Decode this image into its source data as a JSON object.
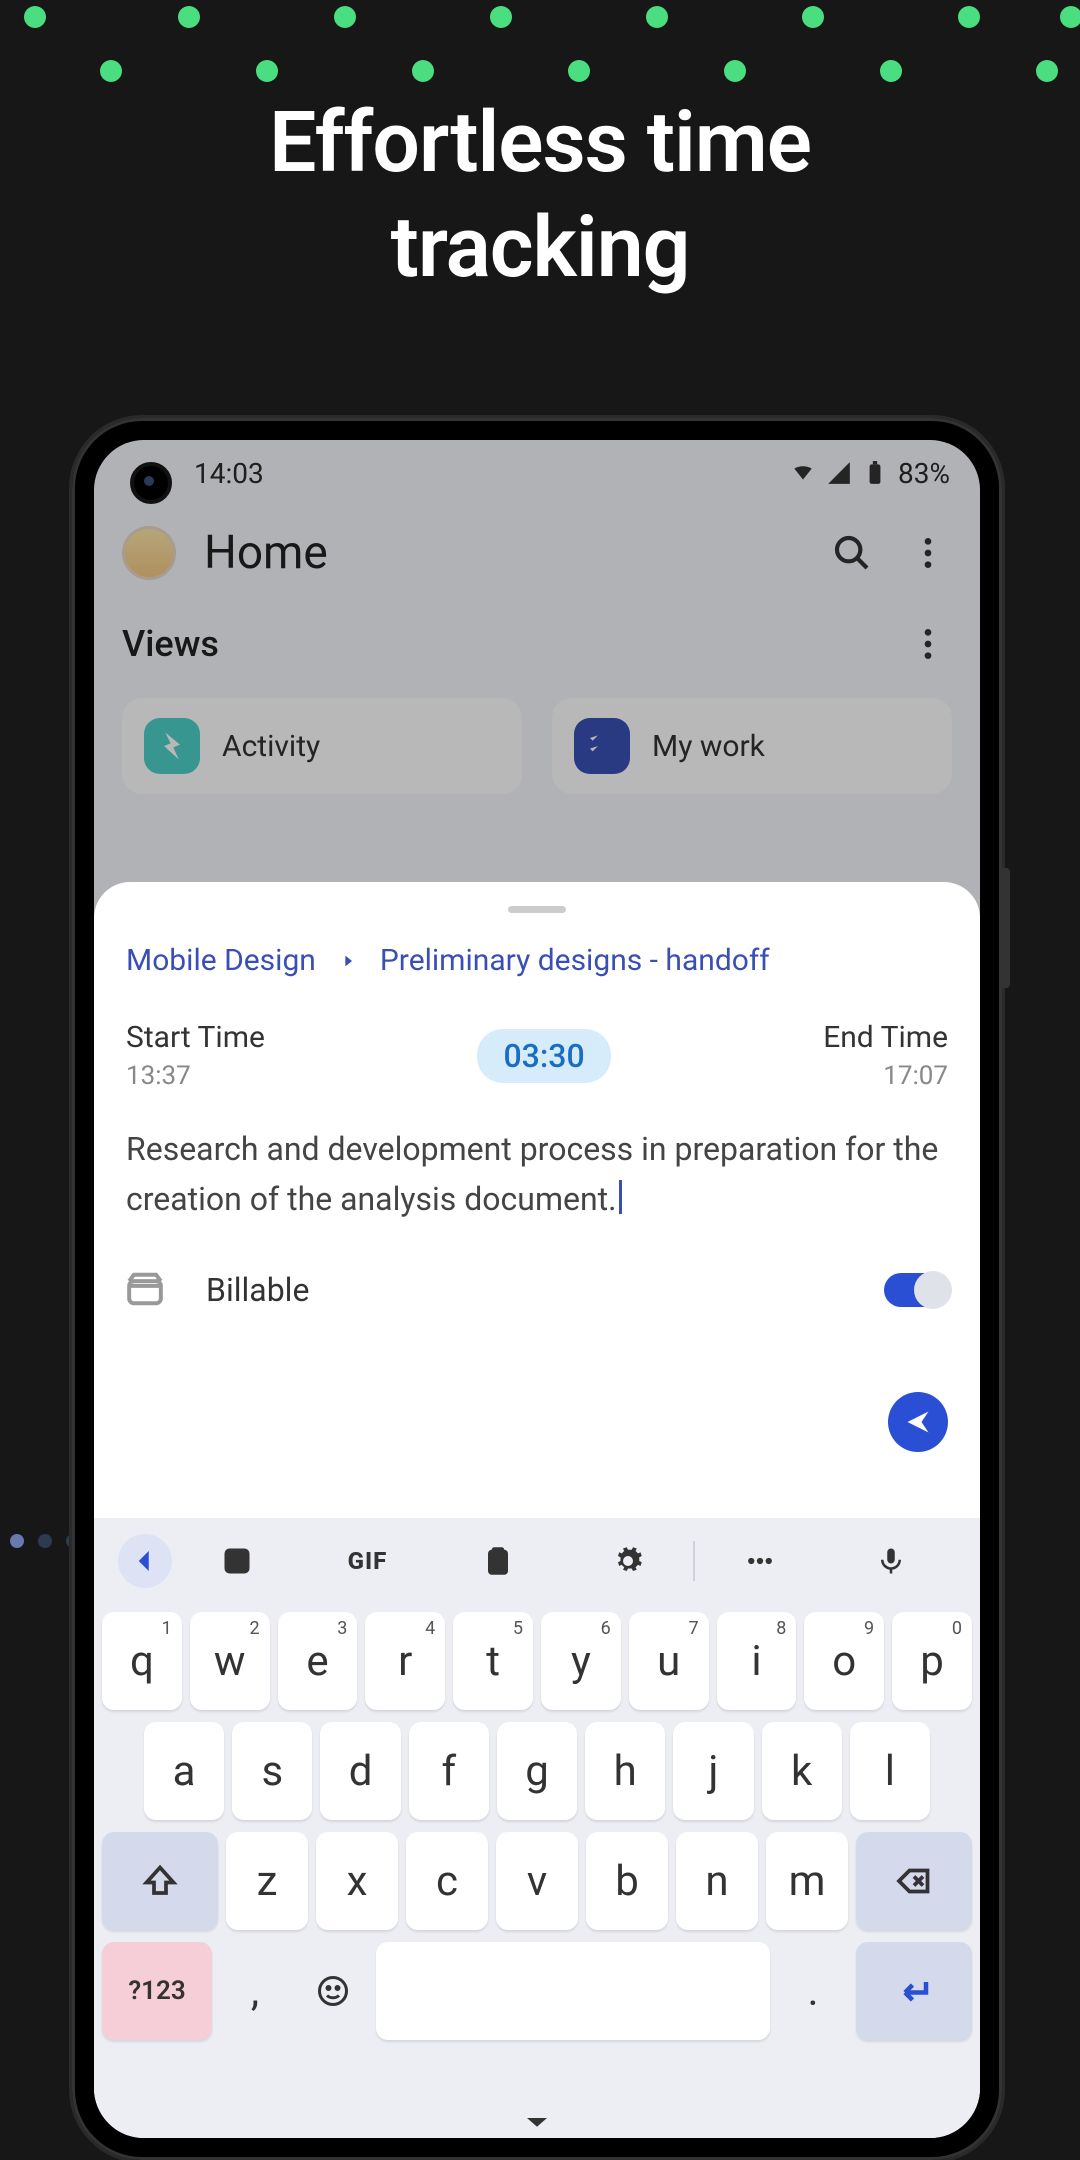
{
  "marketing": {
    "headline": "Effortless time\ntracking"
  },
  "status": {
    "time": "14:03",
    "battery": "83%"
  },
  "header": {
    "title": "Home"
  },
  "views": {
    "heading": "Views",
    "cards": [
      {
        "label": "Activity"
      },
      {
        "label": "My work"
      }
    ]
  },
  "modal": {
    "breadcrumb": {
      "project": "Mobile Design",
      "task": "Preliminary designs - handoff"
    },
    "start": {
      "label": "Start Time",
      "value": "13:37"
    },
    "end": {
      "label": "End Time",
      "value": "17:07"
    },
    "duration": "03:30",
    "description": "Research and development process in preparation for the creation of the analysis document.",
    "billable_label": "Billable"
  },
  "keyboard": {
    "gif": "GIF",
    "sym": "?123",
    "row1": [
      "q",
      "w",
      "e",
      "r",
      "t",
      "y",
      "u",
      "i",
      "o",
      "p"
    ],
    "row1_sup": [
      "1",
      "2",
      "3",
      "4",
      "5",
      "6",
      "7",
      "8",
      "9",
      "0"
    ],
    "row2": [
      "a",
      "s",
      "d",
      "f",
      "g",
      "h",
      "j",
      "k",
      "l"
    ],
    "row3": [
      "z",
      "x",
      "c",
      "v",
      "b",
      "n",
      "m"
    ],
    "comma": ",",
    "period": "."
  }
}
